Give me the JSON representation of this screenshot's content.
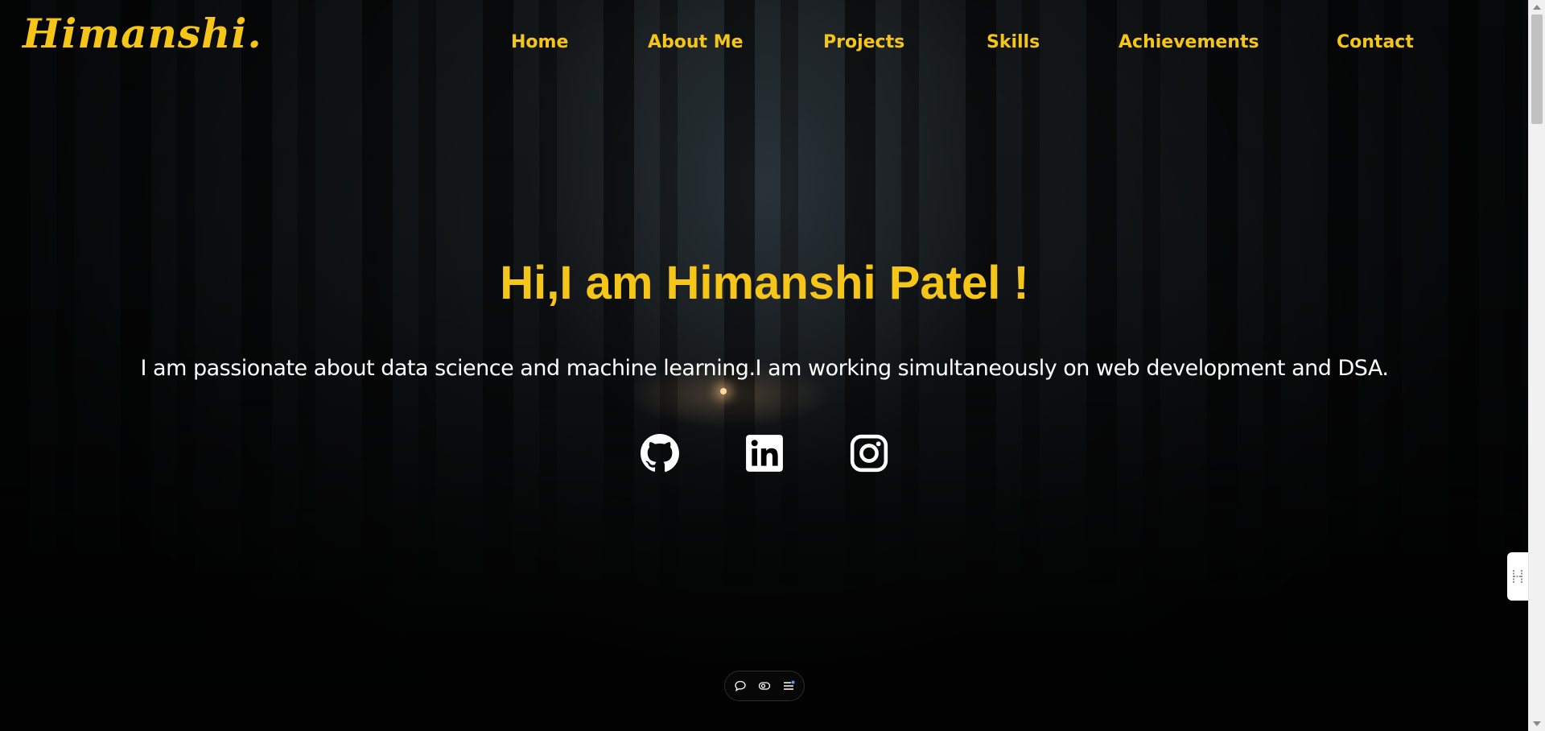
{
  "logo": {
    "text": "Himanshi."
  },
  "nav": {
    "home": "Home",
    "about": "About Me",
    "projects": "Projects",
    "skills": "Skills",
    "achievements": "Achievements",
    "contact": "Contact"
  },
  "hero": {
    "title": "Hi,I am Himanshi Patel !",
    "subtitle": "I am passionate about data science and machine learning.I am working simultaneously on web development and DSA."
  },
  "social": {
    "items": [
      {
        "icon": "github-icon"
      },
      {
        "icon": "linkedin-icon"
      },
      {
        "icon": "instagram-icon"
      }
    ]
  },
  "toolbar": {
    "items": [
      {
        "icon": "comment-icon"
      },
      {
        "icon": "eye-icon"
      },
      {
        "icon": "list-icon"
      }
    ]
  },
  "colors": {
    "accent": "#f5c518",
    "text": "#ffffff",
    "background": "#0b0d0e"
  }
}
